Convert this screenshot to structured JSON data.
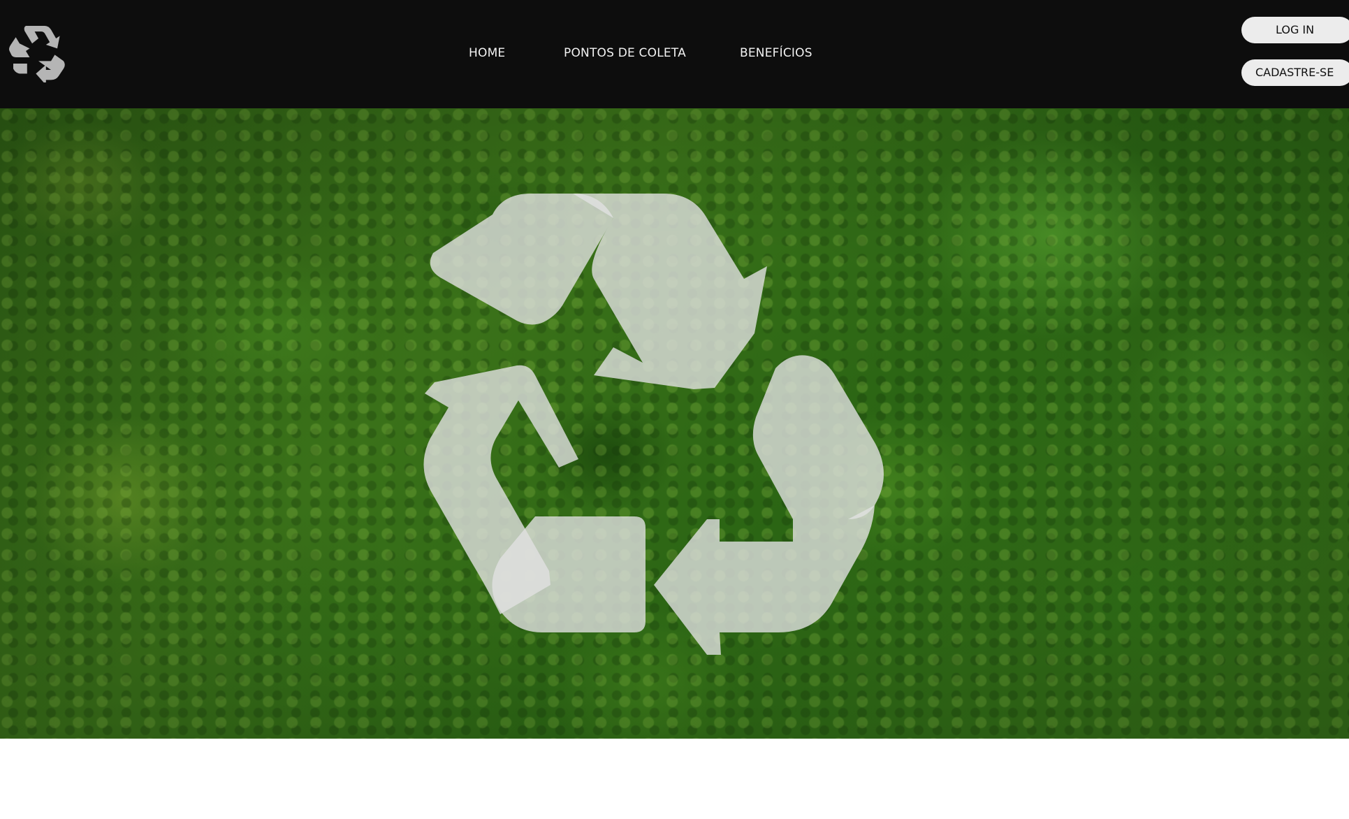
{
  "navbar": {
    "logo_icon": "recycle-icon",
    "links": [
      {
        "label": "HOME"
      },
      {
        "label": "PONTOS DE COLETA"
      },
      {
        "label": "BENEFÍCIOS"
      }
    ],
    "login_label": "LOG IN",
    "signup_label": "CADASTRE-SE"
  },
  "hero": {
    "background": "forest-canopy",
    "overlay_icon": "recycle-icon"
  },
  "colors": {
    "navbar_bg": "#0d0d0d",
    "nav_text": "#f2f2f2",
    "button_bg": "#ececec",
    "recycle_symbol": "#e6e6e6",
    "page_bg": "#ffffff"
  }
}
